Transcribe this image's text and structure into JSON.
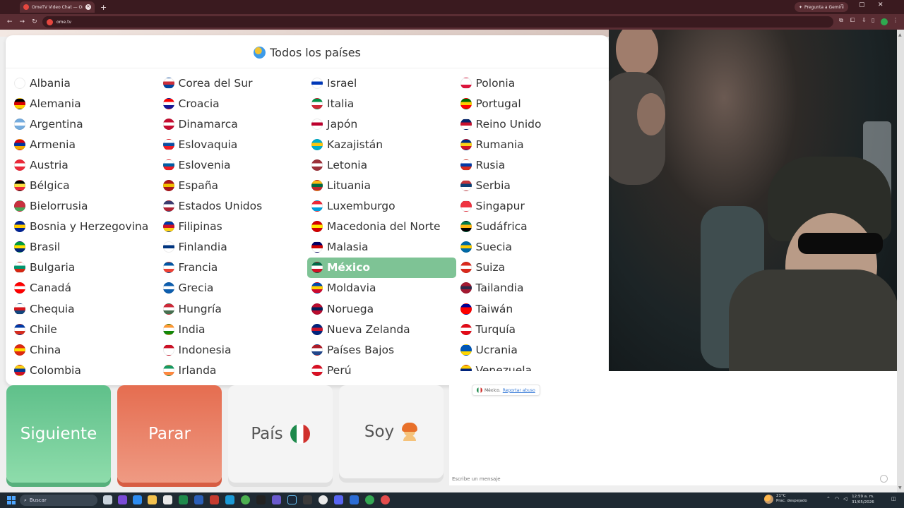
{
  "browser": {
    "tab_title": "OmeTV Video Chat — Ome…",
    "tab_close": "✕",
    "new_tab": "+",
    "gemini_label": "Pregunta a Gemini",
    "url": "ome.tv",
    "minimize": "–",
    "maximize": "▢",
    "close": "✕"
  },
  "country_panel": {
    "title": "Todos los países",
    "selected": "México",
    "countries": [
      {
        "name": "Albania",
        "colors": [
          "#e41e20",
          "#000000"
        ]
      },
      {
        "name": "Alemania",
        "colors": [
          "#000000",
          "#dd0000",
          "#ffce00"
        ]
      },
      {
        "name": "Argentina",
        "colors": [
          "#74acdf",
          "#ffffff",
          "#74acdf"
        ]
      },
      {
        "name": "Armenia",
        "colors": [
          "#d90012",
          "#0033a0",
          "#f2a800"
        ]
      },
      {
        "name": "Austria",
        "colors": [
          "#ed2939",
          "#ffffff",
          "#ed2939"
        ]
      },
      {
        "name": "Bélgica",
        "colors": [
          "#000000",
          "#fae042",
          "#ed2939"
        ]
      },
      {
        "name": "Bielorrusia",
        "colors": [
          "#c8313e",
          "#c8313e",
          "#4aa657"
        ]
      },
      {
        "name": "Bosnia y Herzegovina",
        "colors": [
          "#002395",
          "#fecb00",
          "#002395"
        ]
      },
      {
        "name": "Brasil",
        "colors": [
          "#009c3b",
          "#ffdf00",
          "#002776"
        ]
      },
      {
        "name": "Bulgaria",
        "colors": [
          "#ffffff",
          "#00966e",
          "#d62612"
        ]
      },
      {
        "name": "Canadá",
        "colors": [
          "#ff0000",
          "#ffffff",
          "#ff0000"
        ]
      },
      {
        "name": "Chequia",
        "colors": [
          "#ffffff",
          "#d7141a",
          "#11457e"
        ]
      },
      {
        "name": "Chile",
        "colors": [
          "#0039a6",
          "#ffffff",
          "#d52b1e"
        ]
      },
      {
        "name": "China",
        "colors": [
          "#de2910",
          "#ffde00",
          "#de2910"
        ]
      },
      {
        "name": "Colombia",
        "colors": [
          "#fcd116",
          "#003893",
          "#ce1126"
        ]
      },
      {
        "name": "Corea del Sur",
        "colors": [
          "#ffffff",
          "#cd2e3a",
          "#0047a0"
        ]
      },
      {
        "name": "Croacia",
        "colors": [
          "#ff0000",
          "#ffffff",
          "#171796"
        ]
      },
      {
        "name": "Dinamarca",
        "colors": [
          "#c60c30",
          "#ffffff",
          "#c60c30"
        ]
      },
      {
        "name": "Eslovaquia",
        "colors": [
          "#ffffff",
          "#0b4ea2",
          "#ee1c25"
        ]
      },
      {
        "name": "Eslovenia",
        "colors": [
          "#ffffff",
          "#005da4",
          "#ed1c24"
        ]
      },
      {
        "name": "España",
        "colors": [
          "#aa151b",
          "#f1bf00",
          "#aa151b"
        ]
      },
      {
        "name": "Estados Unidos",
        "colors": [
          "#3c3b6e",
          "#ffffff",
          "#b22234"
        ]
      },
      {
        "name": "Filipinas",
        "colors": [
          "#0038a8",
          "#ce1126",
          "#fcd116"
        ]
      },
      {
        "name": "Finlandia",
        "colors": [
          "#ffffff",
          "#003580",
          "#ffffff"
        ]
      },
      {
        "name": "Francia",
        "colors": [
          "#0055a4",
          "#ffffff",
          "#ef4135"
        ]
      },
      {
        "name": "Grecia",
        "colors": [
          "#0d5eaf",
          "#ffffff",
          "#0d5eaf"
        ]
      },
      {
        "name": "Hungría",
        "colors": [
          "#ce2939",
          "#ffffff",
          "#477050"
        ]
      },
      {
        "name": "India",
        "colors": [
          "#ff9933",
          "#ffffff",
          "#138808"
        ]
      },
      {
        "name": "Indonesia",
        "colors": [
          "#ce1126",
          "#ffffff",
          "#ffffff"
        ]
      },
      {
        "name": "Irlanda",
        "colors": [
          "#169b62",
          "#ffffff",
          "#ff883e"
        ]
      },
      {
        "name": "Israel",
        "colors": [
          "#ffffff",
          "#0038b8",
          "#ffffff"
        ]
      },
      {
        "name": "Italia",
        "colors": [
          "#009246",
          "#ffffff",
          "#ce2b37"
        ]
      },
      {
        "name": "Japón",
        "colors": [
          "#ffffff",
          "#bc002d",
          "#ffffff"
        ]
      },
      {
        "name": "Kazajistán",
        "colors": [
          "#00afca",
          "#fec50c",
          "#00afca"
        ]
      },
      {
        "name": "Letonia",
        "colors": [
          "#9e3039",
          "#ffffff",
          "#9e3039"
        ]
      },
      {
        "name": "Lituania",
        "colors": [
          "#fdb913",
          "#006a44",
          "#c1272d"
        ]
      },
      {
        "name": "Luxemburgo",
        "colors": [
          "#ed2939",
          "#ffffff",
          "#00a1de"
        ]
      },
      {
        "name": "Macedonia del Norte",
        "colors": [
          "#d20000",
          "#ffe600",
          "#d20000"
        ]
      },
      {
        "name": "Malasia",
        "colors": [
          "#010066",
          "#cc0001",
          "#ffffff"
        ]
      },
      {
        "name": "México",
        "colors": [
          "#006847",
          "#ffffff",
          "#ce1126"
        ]
      },
      {
        "name": "Moldavia",
        "colors": [
          "#0046ae",
          "#ffd200",
          "#cc092f"
        ]
      },
      {
        "name": "Noruega",
        "colors": [
          "#ba0c2f",
          "#00205b",
          "#ba0c2f"
        ]
      },
      {
        "name": "Nueva Zelanda",
        "colors": [
          "#00247d",
          "#cc142b",
          "#00247d"
        ]
      },
      {
        "name": "Países Bajos",
        "colors": [
          "#ae1c28",
          "#ffffff",
          "#21468b"
        ]
      },
      {
        "name": "Perú",
        "colors": [
          "#d91023",
          "#ffffff",
          "#d91023"
        ]
      },
      {
        "name": "Polonia",
        "colors": [
          "#ffffff",
          "#ffffff",
          "#dc143c"
        ]
      },
      {
        "name": "Portugal",
        "colors": [
          "#006600",
          "#ffcc00",
          "#ff0000"
        ]
      },
      {
        "name": "Reino Unido",
        "colors": [
          "#012169",
          "#c8102e",
          "#ffffff"
        ]
      },
      {
        "name": "Rumania",
        "colors": [
          "#002b7f",
          "#fcd116",
          "#ce1126"
        ]
      },
      {
        "name": "Rusia",
        "colors": [
          "#ffffff",
          "#0039a6",
          "#d52b1e"
        ]
      },
      {
        "name": "Serbia",
        "colors": [
          "#c6363c",
          "#0c4076",
          "#ffffff"
        ]
      },
      {
        "name": "Singapur",
        "colors": [
          "#ef3340",
          "#ef3340",
          "#ffffff"
        ]
      },
      {
        "name": "Sudáfrica",
        "colors": [
          "#007a4d",
          "#ffb612",
          "#000000"
        ]
      },
      {
        "name": "Suecia",
        "colors": [
          "#006aa7",
          "#fecc00",
          "#006aa7"
        ]
      },
      {
        "name": "Suiza",
        "colors": [
          "#da291c",
          "#ffffff",
          "#da291c"
        ]
      },
      {
        "name": "Tailandia",
        "colors": [
          "#a51931",
          "#2d2a4a",
          "#a51931"
        ]
      },
      {
        "name": "Taiwán",
        "colors": [
          "#000095",
          "#fe0000",
          "#fe0000"
        ]
      },
      {
        "name": "Turquía",
        "colors": [
          "#e30a17",
          "#ffffff",
          "#e30a17"
        ]
      },
      {
        "name": "Ucrania",
        "colors": [
          "#0057b7",
          "#0057b7",
          "#ffd700"
        ]
      },
      {
        "name": "Venezuela",
        "colors": [
          "#ffcc00",
          "#00247d",
          "#cf142b"
        ]
      }
    ]
  },
  "controls": {
    "next_label": "Siguiente",
    "stop_label": "Parar",
    "country_label": "País",
    "gender_label": "Soy"
  },
  "chat": {
    "country_info": "México.",
    "report_link": "Reportar abuso",
    "input_placeholder": "Escribe un mensaje"
  },
  "taskbar": {
    "search_placeholder": "Buscar",
    "weather_temp": "21°C",
    "weather_desc": "Prac. despejado",
    "time": "12:59 a. m.",
    "date": "31/05/2026"
  },
  "colors": {
    "next_button": "#5fc08a",
    "stop_button": "#e56d50",
    "selected_country": "#7ec395",
    "browser_frame": "#5a2d33"
  }
}
